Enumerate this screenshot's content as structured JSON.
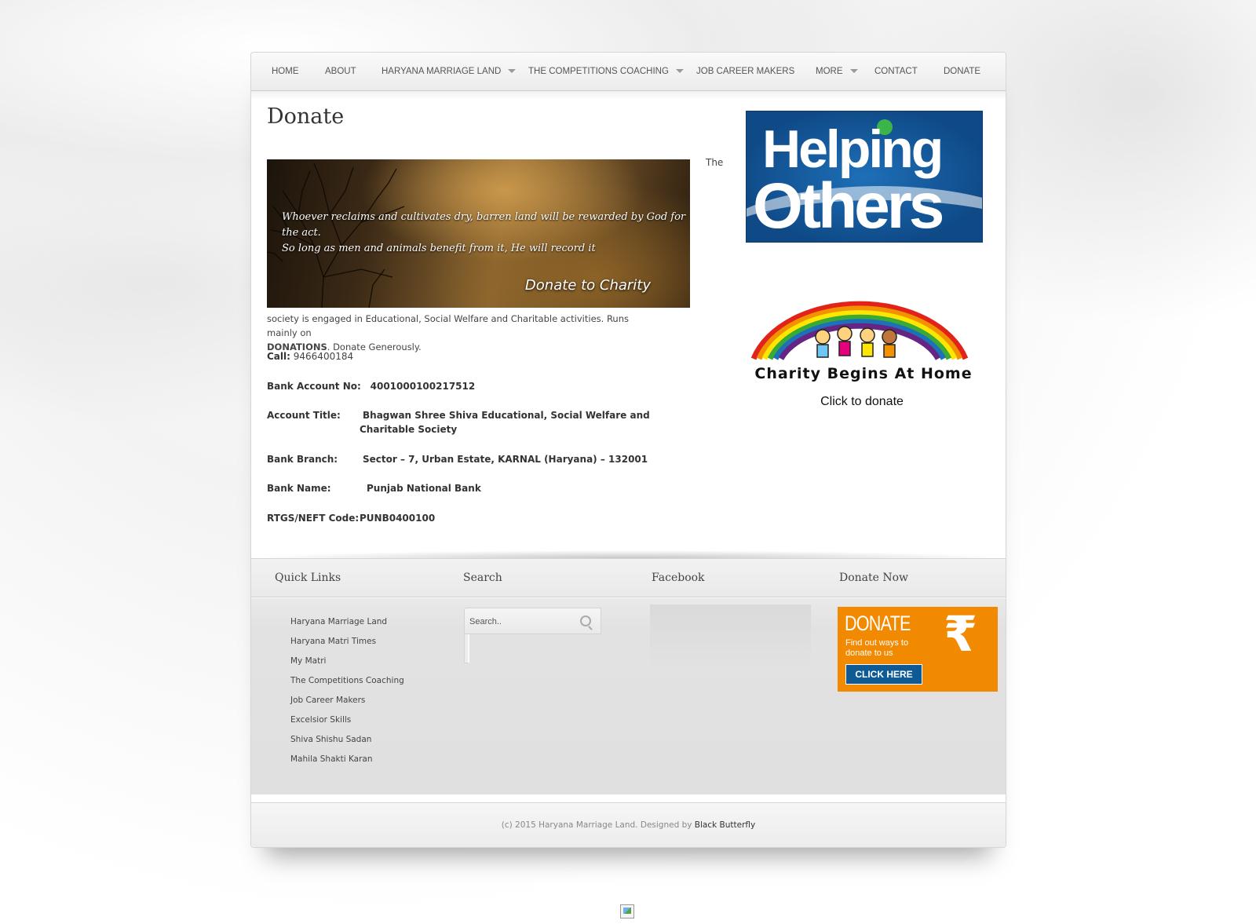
{
  "nav": {
    "items": [
      {
        "label": "HOME",
        "has_dropdown": false
      },
      {
        "label": "ABOUT",
        "has_dropdown": false
      },
      {
        "label": "HARYANA MARRIAGE LAND",
        "has_dropdown": true
      },
      {
        "label": "THE COMPETITIONS COACHING",
        "has_dropdown": true
      },
      {
        "label": "JOB CAREER MAKERS",
        "has_dropdown": false
      },
      {
        "label": "MORE",
        "has_dropdown": true
      },
      {
        "label": "CONTACT",
        "has_dropdown": false
      },
      {
        "label": "DONATE",
        "has_dropdown": false
      }
    ]
  },
  "main": {
    "title": "Donate",
    "banner": {
      "quote_line1": "Whoever reclaims and cultivates dry, barren land will be rewarded by God for the act.",
      "quote_line2": "So long as men and animals benefit from it, He will record it",
      "caption": "Donate to Charity"
    },
    "intro_the": "The",
    "intro_text": "society is engaged in Educational,  Social Welfare and Charitable activities.  Runs  mainly on",
    "intro_bold": "DONATIONS",
    "intro_tail": ".   Donate Generously.",
    "call": {
      "label": "Call:",
      "value": "9466400184"
    },
    "bank_account": {
      "label": "Bank Account No:",
      "value": "4001000100217512"
    },
    "account_title": {
      "label": "Account Title:",
      "value": "Bhagwan  Shree Shiva Educational, Social Welfare and Charitable Society"
    },
    "bank_branch": {
      "label": "Bank Branch:",
      "value": "Sector – 7, Urban Estate,  KARNAL (Haryana) – 132001"
    },
    "bank_name": {
      "label": "Bank Name:",
      "value": "Punjab National Bank"
    },
    "rtgs": {
      "label": "RTGS/NEFT Code:",
      "value": "PUNB0400100"
    }
  },
  "sidebar": {
    "helping": {
      "word1": "Helping",
      "word2": "Others"
    },
    "charity": {
      "title": "Charity Begins At Home",
      "subtitle": "Click to donate"
    }
  },
  "footer": {
    "quick_links": {
      "title": "Quick Links",
      "items": [
        "Haryana Marriage Land",
        "Haryana Matri Times",
        "My Matri",
        "The Competitions Coaching",
        "Job Career Makers",
        "Excelsior Skills",
        "Shiva Shishu Sadan",
        "Mahila Shakti Karan"
      ]
    },
    "search": {
      "title": "Search",
      "placeholder": "Search.."
    },
    "facebook": {
      "title": "Facebook"
    },
    "donate_now": {
      "title": "Donate Now",
      "ad_title": "DONATE",
      "ad_text": "Find out ways to donate to us",
      "ad_symbol": "₹",
      "ad_button": "CLICK HERE"
    },
    "copyright_text": "(c) 2015 Haryana Marriage Land. Designed by",
    "designer": "Black Butterfly"
  },
  "colors": {
    "accent_orange": "#f18a00",
    "helping_blue": "#1e6fb8",
    "button_blue": "#0d5a95"
  }
}
